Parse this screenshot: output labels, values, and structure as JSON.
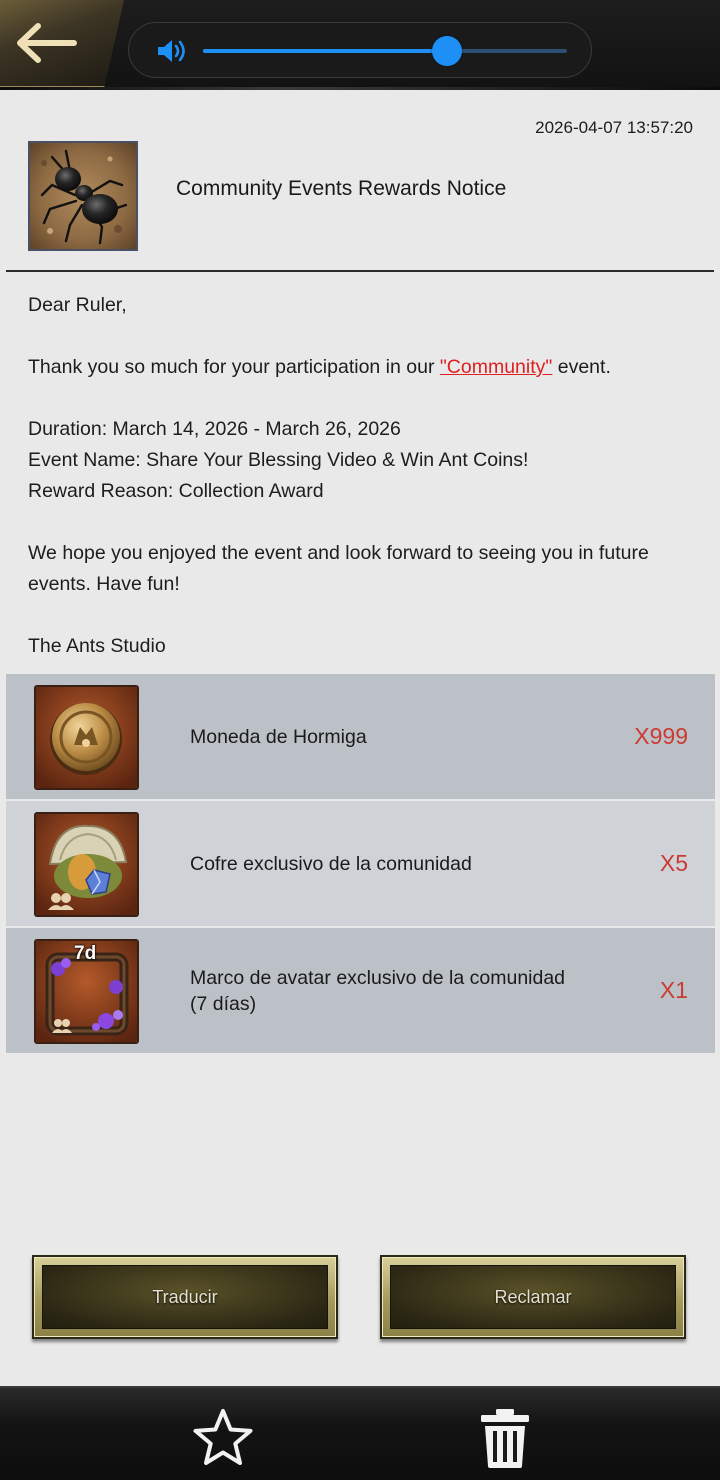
{
  "top_bar": {
    "back_icon": "arrow-left-icon",
    "volume_icon": "speaker-icon",
    "volume_level": 0.67,
    "accent_color": "#1e8ff5"
  },
  "mail": {
    "date": "2026-04-07 13:57:20",
    "title": "Community Events Rewards Notice",
    "greeting": "Dear Ruler,",
    "thanks_before": "Thank you so much for your participation in our ",
    "community_link": "\"Community\"",
    "thanks_after": " event.",
    "duration": "Duration: March 14, 2026 - March 26, 2026",
    "event_name": "Event Name: Share Your Blessing Video & Win Ant Coins!",
    "reward_reason": "Reward Reason: Collection Award",
    "closing": "We hope you enjoyed the event and look forward to seeing you in future events. Have fun!",
    "signature": "The Ants Studio"
  },
  "rewards": [
    {
      "name": "Moneda de Hormiga",
      "qty": "X999",
      "icon": "ant-coin-icon"
    },
    {
      "name": "Cofre exclusivo de la comunidad",
      "qty": "X5",
      "icon": "community-chest-icon"
    },
    {
      "name": "Marco de avatar exclusivo de la comunidad (7 días)",
      "qty": "X1",
      "icon": "avatar-frame-icon",
      "badge": "7d"
    }
  ],
  "actions": {
    "translate_label": "Traducir",
    "claim_label": "Reclamar"
  },
  "bottom_bar": {
    "favorite_icon": "star-icon",
    "delete_icon": "trash-icon"
  }
}
